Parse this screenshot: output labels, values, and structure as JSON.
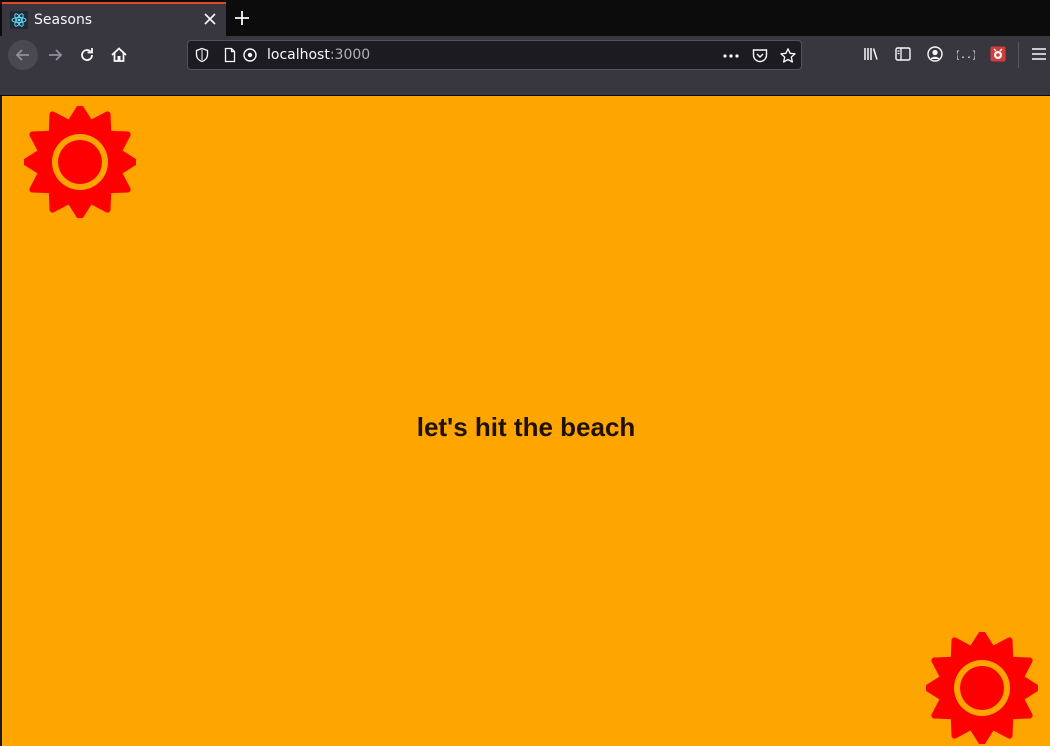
{
  "browser": {
    "tab": {
      "title": "Seasons",
      "favicon": "react-icon"
    },
    "url": {
      "host": "localhost",
      "port": ":3000"
    },
    "toolbar_icons": [
      "back-icon",
      "forward-icon",
      "reload-icon",
      "home-icon",
      "library-icon",
      "sidebar-icon",
      "account-icon",
      "json-viewer-icon",
      "extension-icon",
      "menu-icon"
    ],
    "urlbar_icons": [
      "shield-icon",
      "page-icon",
      "connection-icon",
      "more-dots-icon",
      "pocket-icon",
      "bookmark-star-icon"
    ]
  },
  "page": {
    "background_color": "#ffa500",
    "sun_color": "#ff0000",
    "sun_icon": "sun-icon",
    "message": "let's hit the beach"
  }
}
